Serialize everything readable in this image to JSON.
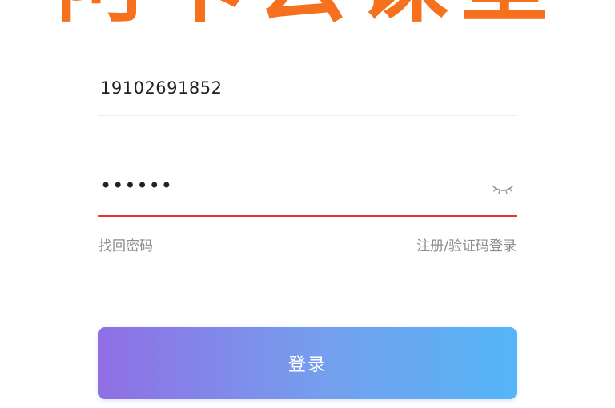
{
  "brand": {
    "logo_text": "阿卡云课堂",
    "color": "#f5711d"
  },
  "form": {
    "phone": {
      "value": "19102691852"
    },
    "password": {
      "masked_value": "••••••",
      "toggle_icon": "eye-closed-icon",
      "active_underline_color": "#e8333a"
    },
    "links": {
      "forgot": "找回密码",
      "register": "注册/验证码登录"
    },
    "submit": {
      "label": "登录",
      "gradient": [
        "#8f6fe4",
        "#55b5f7"
      ]
    }
  }
}
